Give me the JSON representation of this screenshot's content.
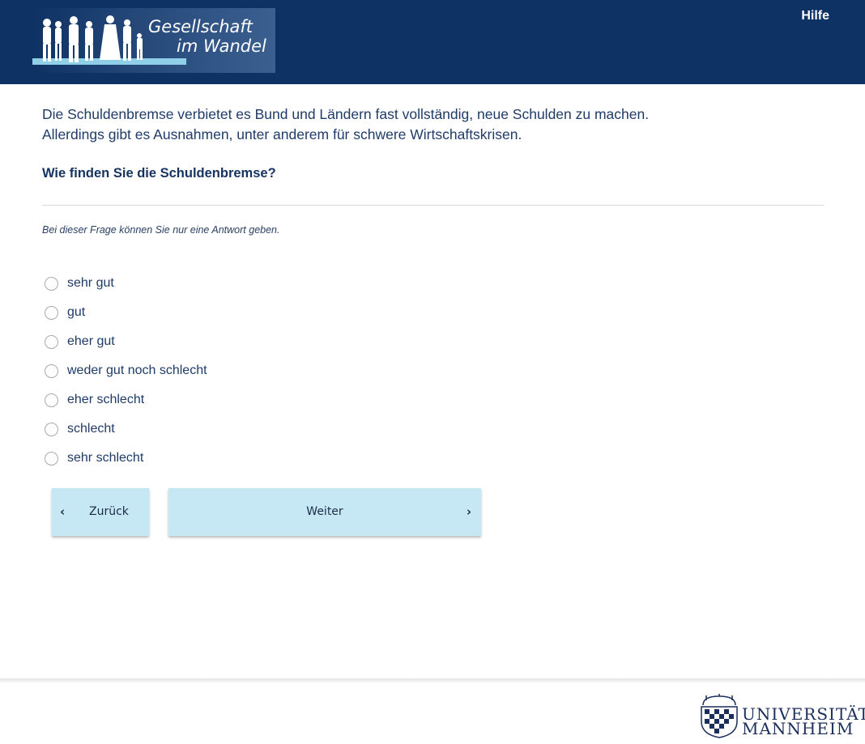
{
  "header": {
    "logo_line1": "Gesellschaft",
    "logo_line2": "im Wandel",
    "help_label": "Hilfe"
  },
  "question": {
    "intro_line1": "Die Schuldenbremse verbietet es Bund und Ländern fast vollständig, neue Schulden zu machen.",
    "intro_line2": "Allerdings gibt es Ausnahmen, unter anderem für schwere Wirtschaftskrisen.",
    "title": "Wie finden Sie die Schuldenbremse?",
    "hint": "Bei dieser Frage können Sie nur eine Antwort geben.",
    "options": [
      {
        "label": "sehr gut"
      },
      {
        "label": "gut"
      },
      {
        "label": "eher gut"
      },
      {
        "label": "weder gut noch schlecht"
      },
      {
        "label": "eher schlecht"
      },
      {
        "label": "schlecht"
      },
      {
        "label": "sehr schlecht"
      }
    ]
  },
  "nav": {
    "back_label": "Zurück",
    "next_label": "Weiter"
  },
  "footer": {
    "uni_line1": "UNIVERSITÄT",
    "uni_line2": "MANNHEIM"
  },
  "colors": {
    "header_bg": "#0d3263",
    "button_bg": "#c6e7f4",
    "text": "#1f3b68"
  }
}
